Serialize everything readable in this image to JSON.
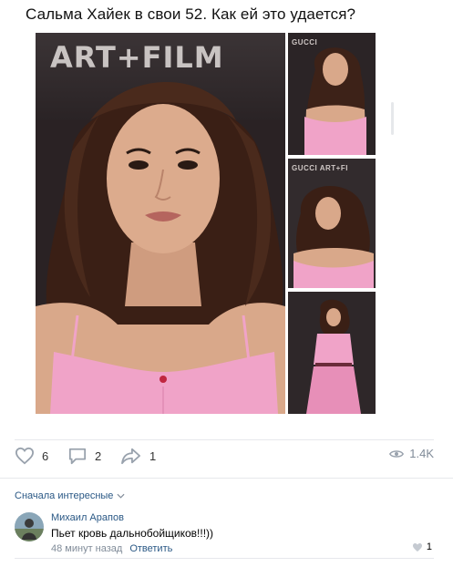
{
  "post": {
    "title": "Сальма Хайек в свои 52. Как ей это удается?",
    "backdrop_text": "ART+FILM",
    "thumb_labels": [
      "GUCCI",
      "GUCCI ART+FI",
      ""
    ]
  },
  "actions": {
    "likes": "6",
    "comments": "2",
    "shares": "1",
    "views": "1.4K"
  },
  "comments_section": {
    "sort_label": "Сначала интересные"
  },
  "comment": {
    "author": "Михаил Арапов",
    "text": "Пьет кровь дальнобойщиков!!!))",
    "time": "48 минут назад",
    "reply_label": "Ответить",
    "likes": "1"
  },
  "colors": {
    "link": "#2a5885",
    "muted": "#818c99",
    "icon": "#99a2ad",
    "divider": "#e7e8ec",
    "dress_pink": "#f0a3c8"
  },
  "icons": [
    "heart-icon",
    "comment-icon",
    "share-icon",
    "eye-icon",
    "chevron-down-icon"
  ]
}
